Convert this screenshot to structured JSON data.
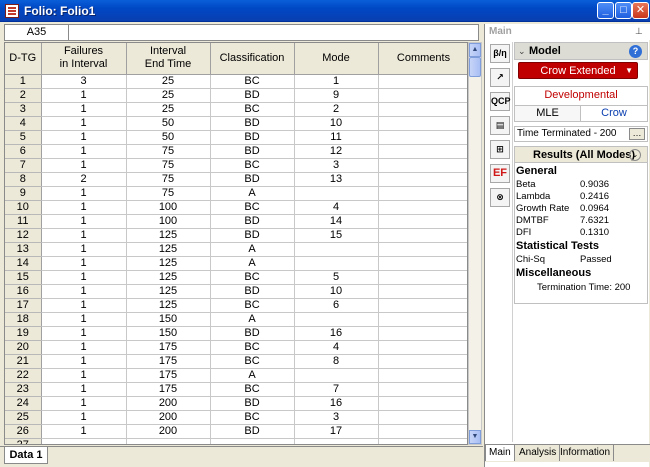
{
  "window": {
    "title": "Folio: Folio1"
  },
  "cellbar": {
    "ref": "A35",
    "value": ""
  },
  "table": {
    "columns": [
      "D-TG",
      "Failures\nin Interval",
      "Interval\nEnd Time",
      "Classification",
      "Mode",
      "Comments"
    ],
    "rows": [
      [
        "1",
        "3",
        "25",
        "BC",
        "1",
        ""
      ],
      [
        "2",
        "1",
        "25",
        "BD",
        "9",
        ""
      ],
      [
        "3",
        "1",
        "25",
        "BC",
        "2",
        ""
      ],
      [
        "4",
        "1",
        "50",
        "BD",
        "10",
        ""
      ],
      [
        "5",
        "1",
        "50",
        "BD",
        "11",
        ""
      ],
      [
        "6",
        "1",
        "75",
        "BD",
        "12",
        ""
      ],
      [
        "7",
        "1",
        "75",
        "BC",
        "3",
        ""
      ],
      [
        "8",
        "2",
        "75",
        "BD",
        "13",
        ""
      ],
      [
        "9",
        "1",
        "75",
        "A",
        "",
        ""
      ],
      [
        "10",
        "1",
        "100",
        "BC",
        "4",
        ""
      ],
      [
        "11",
        "1",
        "100",
        "BD",
        "14",
        ""
      ],
      [
        "12",
        "1",
        "125",
        "BD",
        "15",
        ""
      ],
      [
        "13",
        "1",
        "125",
        "A",
        "",
        ""
      ],
      [
        "14",
        "1",
        "125",
        "A",
        "",
        ""
      ],
      [
        "15",
        "1",
        "125",
        "BC",
        "5",
        ""
      ],
      [
        "16",
        "1",
        "125",
        "BD",
        "10",
        ""
      ],
      [
        "17",
        "1",
        "125",
        "BC",
        "6",
        ""
      ],
      [
        "18",
        "1",
        "150",
        "A",
        "",
        ""
      ],
      [
        "19",
        "1",
        "150",
        "BD",
        "16",
        ""
      ],
      [
        "20",
        "1",
        "175",
        "BC",
        "4",
        ""
      ],
      [
        "21",
        "1",
        "175",
        "BC",
        "8",
        ""
      ],
      [
        "22",
        "1",
        "175",
        "A",
        "",
        ""
      ],
      [
        "23",
        "1",
        "175",
        "BC",
        "7",
        ""
      ],
      [
        "24",
        "1",
        "200",
        "BD",
        "16",
        ""
      ],
      [
        "25",
        "1",
        "200",
        "BC",
        "3",
        ""
      ],
      [
        "26",
        "1",
        "200",
        "BD",
        "17",
        ""
      ],
      [
        "27",
        "",
        "",
        "",
        "",
        ""
      ]
    ]
  },
  "sheet_tabs": [
    "Data 1"
  ],
  "panel": {
    "header": "Main",
    "model_label": "Model",
    "model_value": "Crow Extended",
    "developmental": "Developmental",
    "method_left": "MLE",
    "method_right": "Crow",
    "time_option": "Time Terminated - 200",
    "results_title": "Results (All Modes)",
    "general_label": "General",
    "general": [
      {
        "key": "Beta",
        "value": "0.9036"
      },
      {
        "key": "Lambda",
        "value": "0.2416"
      },
      {
        "key": "Growth Rate",
        "value": "0.0964"
      },
      {
        "key": "DMTBF",
        "value": "7.6321"
      },
      {
        "key": "DFI",
        "value": "0.1310"
      }
    ],
    "tests_label": "Statistical Tests",
    "tests": [
      {
        "key": "Chi-Sq",
        "value": "Passed"
      }
    ],
    "misc_label": "Miscellaneous",
    "termination": "Termination Time: 200",
    "tabs": [
      "Main",
      "Analysis",
      "Information"
    ],
    "tools": [
      "β/η",
      "plot",
      "QCP",
      "rpt",
      "calc",
      "EF",
      "dist"
    ]
  },
  "colors": {
    "titlebar": "#0047c4",
    "accent_red": "#c00000",
    "link_blue": "#0a3fb0"
  }
}
